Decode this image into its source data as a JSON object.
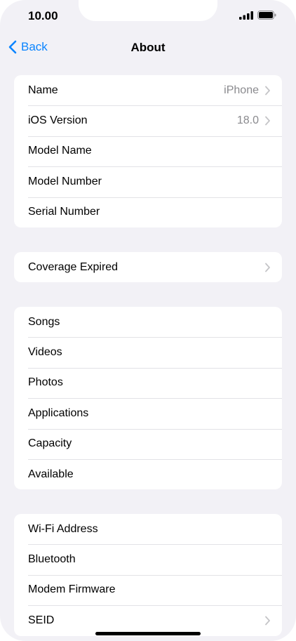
{
  "status_bar": {
    "time": "10.00"
  },
  "nav": {
    "back_label": "Back",
    "title": "About"
  },
  "groups": [
    {
      "rows": [
        {
          "label": "Name",
          "value": "iPhone",
          "chevron": true
        },
        {
          "label": "iOS Version",
          "value": "18.0",
          "chevron": true
        },
        {
          "label": "Model Name",
          "value": "",
          "chevron": false
        },
        {
          "label": "Model Number",
          "value": "",
          "chevron": false
        },
        {
          "label": "Serial Number",
          "value": "",
          "chevron": false
        }
      ]
    },
    {
      "rows": [
        {
          "label": "Coverage Expired",
          "value": "",
          "chevron": true
        }
      ]
    },
    {
      "rows": [
        {
          "label": "Songs",
          "value": "",
          "chevron": false
        },
        {
          "label": "Videos",
          "value": "",
          "chevron": false
        },
        {
          "label": "Photos",
          "value": "",
          "chevron": false
        },
        {
          "label": "Applications",
          "value": "",
          "chevron": false
        },
        {
          "label": "Capacity",
          "value": "",
          "chevron": false
        },
        {
          "label": "Available",
          "value": "",
          "chevron": false
        }
      ]
    },
    {
      "rows": [
        {
          "label": "Wi-Fi Address",
          "value": "",
          "chevron": false
        },
        {
          "label": "Bluetooth",
          "value": "",
          "chevron": false
        },
        {
          "label": "Modem Firmware",
          "value": "",
          "chevron": false
        },
        {
          "label": "SEID",
          "value": "",
          "chevron": true
        }
      ]
    }
  ],
  "colors": {
    "accent": "#0a84ff",
    "background": "#f2f1f6",
    "secondary_text": "#8a8a8e"
  },
  "icons": [
    "chevron-left-icon",
    "chevron-right-icon",
    "signal-icon",
    "battery-icon"
  ]
}
